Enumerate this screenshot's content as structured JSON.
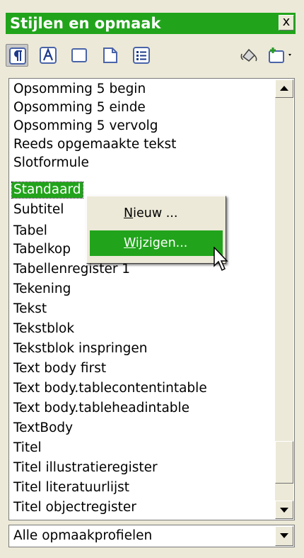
{
  "title": "Stijlen en opmaak",
  "close_label": "x",
  "toolbar": {
    "buttons": [
      {
        "name": "paragraph-styles-icon",
        "active": true
      },
      {
        "name": "character-styles-icon",
        "active": false
      },
      {
        "name": "frame-styles-icon",
        "active": false
      },
      {
        "name": "page-styles-icon",
        "active": false
      },
      {
        "name": "list-styles-icon",
        "active": false
      },
      {
        "name": "fill-format-mode-icon",
        "active": false
      },
      {
        "name": "new-style-from-selection-icon",
        "active": false
      }
    ]
  },
  "list": {
    "items": [
      "Opsomming 5 begin",
      "Opsomming 5 einde",
      "Opsomming 5 vervolg",
      "Reeds opgemaakte tekst",
      "Slotformule",
      "Standaard",
      "Subtitel",
      "Tabel",
      "Tabelkop",
      "Tabellenregister 1",
      "Tekening",
      "Tekst",
      "Tekstblok",
      "Tekstblok inspringen",
      "Text body first",
      "Text body.tablecontentintable",
      "Text body.tableheadintable",
      "TextBody",
      "Titel",
      "Titel illustratieregister",
      "Titel literatuurlijst",
      "Titel objectregister"
    ],
    "selected_index": 5,
    "scroll_position": 0.85
  },
  "context_menu": {
    "items": [
      {
        "label": "Nieuw ...",
        "underline": "N",
        "rest": "ieuw ..."
      },
      {
        "label": "Wijzigen...",
        "underline": "W",
        "rest": "ijzigen..."
      }
    ],
    "highlighted_index": 1
  },
  "filter": {
    "selected": "Alle opmaakprofielen"
  },
  "colors": {
    "accent": "#21a41b",
    "window_bg": "#ece9d8"
  }
}
